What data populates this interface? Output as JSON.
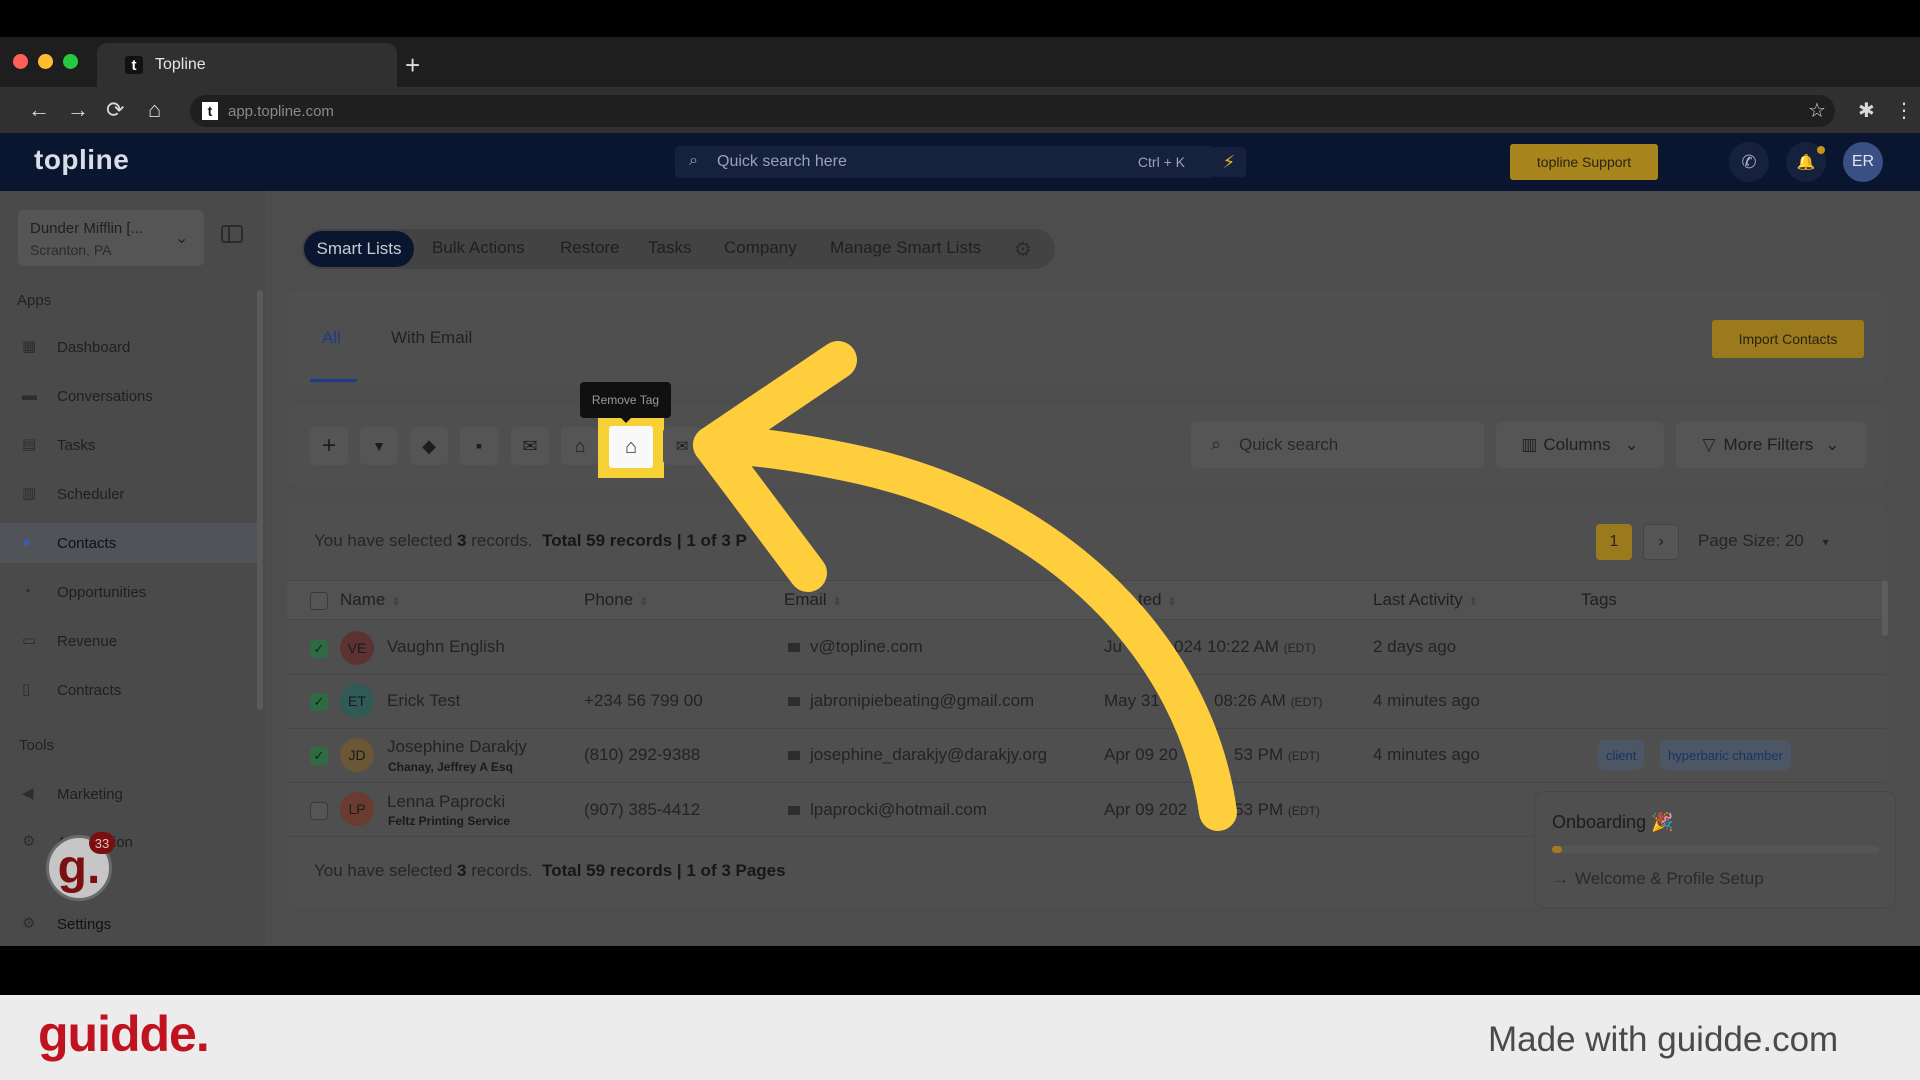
{
  "browser": {
    "tab_title": "Topline",
    "tab_favicon": "t",
    "url": "app.topline.com",
    "new_tab": "+",
    "back": "←",
    "forward": "→",
    "reload": "⟳",
    "home": "⌂",
    "star": "☆",
    "extensions": "✱",
    "menu": "⋮",
    "traffic_colors": [
      "#ff5f57",
      "#febc2e",
      "#28c840"
    ]
  },
  "header": {
    "logo": "topline",
    "search_placeholder": "Quick search here",
    "search_shortcut": "Ctrl + K",
    "bolt": "⚡",
    "support_button": "topline Support",
    "phone": "✆",
    "bell": "🔔",
    "avatar": "ER"
  },
  "sidebar": {
    "location_name": "Dunder Mifflin [...",
    "location_sub": "Scranton, PA",
    "chevron": "⌄",
    "apps_heading": "Apps",
    "tools_heading": "Tools",
    "apps": [
      {
        "label": "Dashboard",
        "icon": "▦"
      },
      {
        "label": "Conversations",
        "icon": "▬"
      },
      {
        "label": "Tasks",
        "icon": "▤"
      },
      {
        "label": "Scheduler",
        "icon": "▥"
      },
      {
        "label": "Contacts",
        "icon": "●"
      },
      {
        "label": "Opportunities",
        "icon": "◔"
      },
      {
        "label": "Revenue",
        "icon": "▭"
      },
      {
        "label": "Contracts",
        "icon": "▯"
      }
    ],
    "tools": [
      {
        "label": "Marketing",
        "icon": "◀"
      },
      {
        "label": "Automation",
        "icon": "⚙"
      }
    ],
    "settings": {
      "label": "Settings",
      "icon": "⚙"
    },
    "guidde_badge": "g.",
    "guidde_count": "33"
  },
  "topnav": {
    "items": [
      "Smart Lists",
      "Bulk Actions",
      "Restore",
      "Tasks",
      "Company",
      "Manage Smart Lists"
    ],
    "gear": "⚙"
  },
  "subtabs": [
    "All",
    "With Email"
  ],
  "import_button": "Import Contacts",
  "toolbar": {
    "icons": [
      "+",
      "▼",
      "◆",
      "▪",
      "✉",
      "⌂"
    ],
    "remove_tag_icon": "⌂",
    "last_icon": "✉",
    "tooltip": "Remove Tag",
    "search_placeholder": "Quick search",
    "search_icon": "⌕",
    "columns": "Columns",
    "more_filters": "More Filters",
    "dropdown_chevron": "⌄",
    "columns_icon": "▥",
    "filter_icon": "▽"
  },
  "selection": {
    "selected_prefix": "You have selected ",
    "selected_count": "3",
    "selected_suffix": " records.",
    "total_top": "Total 59 records | 1 of 3 P",
    "total_bottom": "Total 59 records | 1 of 3 Pages"
  },
  "pagination": {
    "current": "1",
    "next": "›",
    "page_size": "Page Size: 20",
    "page_size_chevron": "▾"
  },
  "table": {
    "columns": [
      "Name",
      "Phone",
      "Email",
      "ted",
      "Last Activity",
      "Tags"
    ],
    "sort_icon": "⇕",
    "check": "✓",
    "rows": [
      {
        "initials": "VE",
        "avatar_color": "#5c3333",
        "name": "Vaughn English",
        "company": "",
        "phone": "",
        "email": "v@topline.com",
        "created_a": "Ju",
        "created_b": "024 10:22 AM",
        "tz": "(EDT)",
        "activity": "2 days ago",
        "checked": true
      },
      {
        "initials": "ET",
        "avatar_color": "#2f5a55",
        "name": "Erick Test",
        "company": "",
        "phone": "+234 56 799 00",
        "email": "jabronipiebeating@gmail.com",
        "created_a": "May 31",
        "created_b": "08:26 AM",
        "tz": "(EDT)",
        "activity": "4 minutes ago",
        "checked": true
      },
      {
        "initials": "JD",
        "avatar_color": "#6b5636",
        "name": "Josephine Darakjy",
        "company": "Chanay, Jeffrey A Esq",
        "phone": "(810) 292-9388",
        "email": "josephine_darakjy@darakjy.org",
        "created_a": "Apr 09 20",
        "created_b": "53 PM",
        "tz": "(EDT)",
        "activity": "4 minutes ago",
        "checked": true
      },
      {
        "initials": "LP",
        "avatar_color": "#6a3c2f",
        "name": "Lenna Paprocki",
        "company": "Feltz Printing Service",
        "phone": "(907) 385-4412",
        "email": "lpaprocki@hotmail.com",
        "created_a": "Apr 09 202",
        "created_b": "53 PM",
        "tz": "(EDT)",
        "activity": "",
        "checked": false
      }
    ],
    "tags": [
      "client",
      "hyperbaric chamber"
    ]
  },
  "onboarding": {
    "title": "Onboarding 🎉",
    "progress": 0.03,
    "arrow": "→",
    "link": "Welcome & Profile Setup"
  },
  "footer": {
    "logo": "guidde.",
    "made_with": "Made with guidde.com"
  },
  "colors": {
    "header_bg": "#0a1630",
    "accent_gold": "#a9851e",
    "highlight_yellow": "#f7d036",
    "annotation_arrow": "#ffce3d",
    "guidde_red": "#c1121f"
  }
}
